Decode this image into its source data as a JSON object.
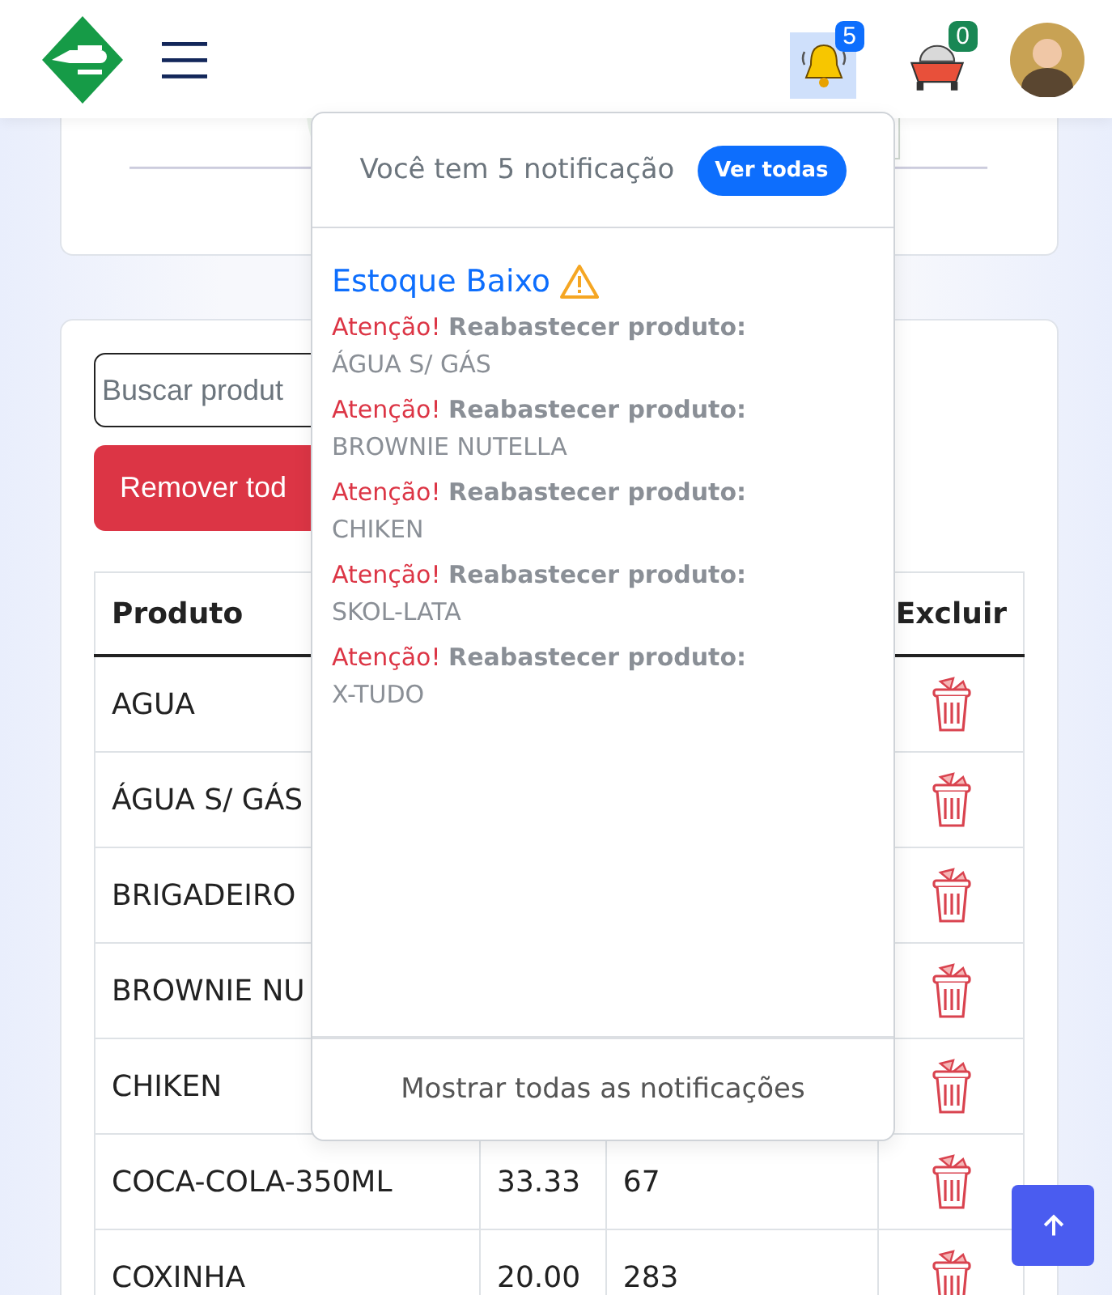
{
  "header": {
    "notification_count": "5",
    "cart_count": "0"
  },
  "search": {
    "placeholder": "Buscar produt"
  },
  "remove_button": "Remover tod",
  "table": {
    "columns": [
      "Produto",
      "",
      "",
      "Excluir"
    ],
    "rows": [
      {
        "cells": [
          "AGUA",
          "",
          ""
        ]
      },
      {
        "cells": [
          "ÁGUA S/ GÁS",
          "",
          ""
        ]
      },
      {
        "cells": [
          "BRIGADEIRO",
          "",
          ""
        ]
      },
      {
        "cells": [
          "BROWNIE NU",
          "",
          ""
        ]
      },
      {
        "cells": [
          "CHIKEN",
          "",
          ""
        ]
      },
      {
        "cells": [
          "COCA-COLA-350ML",
          "33.33",
          "67"
        ]
      },
      {
        "cells": [
          "COXINHA",
          "20.00",
          "283"
        ]
      }
    ]
  },
  "notifications": {
    "title": "Você tem 5 notificação",
    "view_all": "Ver todas",
    "section": "Estoque Baixo",
    "items": [
      {
        "alert": "Atenção!",
        "message": "Reabastecer produto:",
        "product": "ÁGUA S/ GÁS"
      },
      {
        "alert": "Atenção!",
        "message": "Reabastecer produto:",
        "product": "BROWNIE NUTELLA"
      },
      {
        "alert": "Atenção!",
        "message": "Reabastecer produto:",
        "product": "CHIKEN"
      },
      {
        "alert": "Atenção!",
        "message": "Reabastecer produto:",
        "product": "SKOL-LATA"
      },
      {
        "alert": "Atenção!",
        "message": "Reabastecer produto:",
        "product": "X-TUDO"
      }
    ],
    "footer": "Mostrar todas as notificações"
  }
}
